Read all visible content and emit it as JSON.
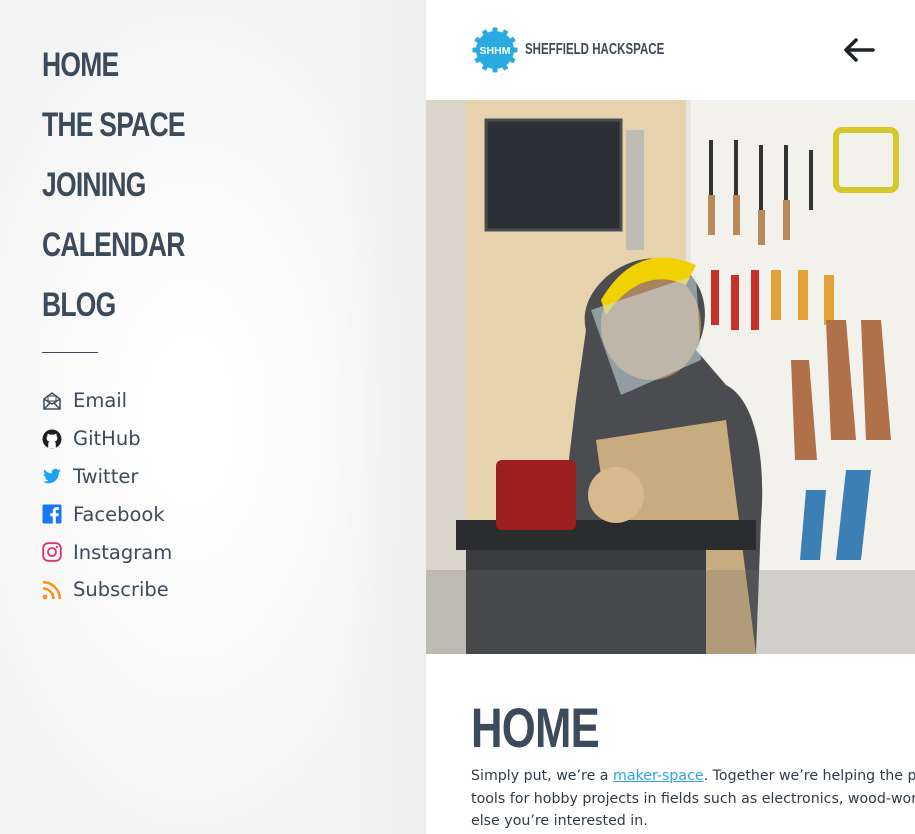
{
  "sidebar": {
    "menu": [
      {
        "label": "Home"
      },
      {
        "label": "The Space"
      },
      {
        "label": "Joining"
      },
      {
        "label": "Calendar"
      },
      {
        "label": "Blog"
      }
    ],
    "social": [
      {
        "label": "Email",
        "icon": "email-icon"
      },
      {
        "label": "GitHub",
        "icon": "github-icon"
      },
      {
        "label": "Twitter",
        "icon": "twitter-icon"
      },
      {
        "label": "Facebook",
        "icon": "facebook-icon"
      },
      {
        "label": "Instagram",
        "icon": "instagram-icon"
      },
      {
        "label": "Subscribe",
        "icon": "rss-icon"
      }
    ]
  },
  "header": {
    "logo_text": "SHHM",
    "site_name": "Sheffield Hackspace",
    "back_icon": "arrow-left-icon"
  },
  "hero": {
    "description_icon": "workshop-photo"
  },
  "content": {
    "title": "Home",
    "intro_line1_before": "Simply put, we’re a ",
    "intro_link": "maker-space",
    "intro_line1_after": ". Together we’re helping the peo",
    "intro_line2": "tools for hobby projects in fields such as electronics, wood-work",
    "intro_line3": "else you’re interested in."
  },
  "colors": {
    "navy": "#3c4b5c",
    "brand_blue": "#29abe2",
    "link": "#2aa7df",
    "twitter": "#1da1f2",
    "facebook": "#1877f2",
    "instagram": "#e1306c",
    "rss": "#f7931e"
  }
}
